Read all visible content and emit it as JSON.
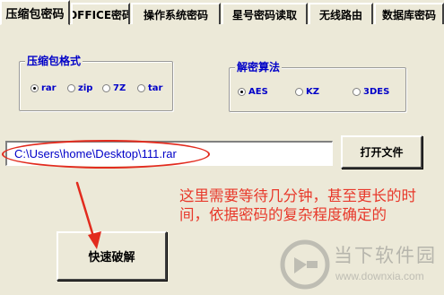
{
  "tabs": [
    {
      "label": "压缩包密码",
      "active": true
    },
    {
      "label": "OFFICE密码",
      "active": false
    },
    {
      "label": "操作系统密码",
      "active": false
    },
    {
      "label": "星号密码读取",
      "active": false
    },
    {
      "label": "无线路由",
      "active": false
    },
    {
      "label": "数据库密码",
      "active": false
    }
  ],
  "archive_format": {
    "title": "压缩包格式",
    "options": [
      "rar",
      "zip",
      "7Z",
      "tar"
    ],
    "selected": "rar"
  },
  "decrypt_algorithm": {
    "title": "解密算法",
    "options": [
      "AES",
      "KZ",
      "3DES"
    ],
    "selected": "AES"
  },
  "file_path": {
    "value": "C:\\Users\\home\\Desktop\\111.rar"
  },
  "buttons": {
    "open_file": "打开文件",
    "quick_crack": "快速破解"
  },
  "annotation": {
    "text": "这里需要等待几分钟，甚至更长的时间，依据密码的复杂程度确定的"
  },
  "watermark": {
    "title": "当下软件园",
    "url": "www.downxia.com"
  },
  "colors": {
    "accent_blue": "#0000c8",
    "annotation_red": "#e8392b",
    "window_bg": "#ece9d8"
  }
}
